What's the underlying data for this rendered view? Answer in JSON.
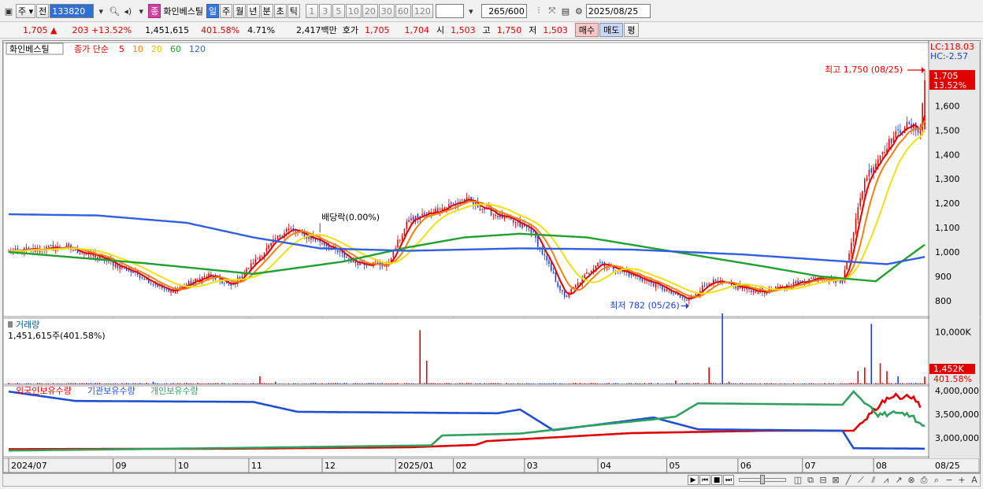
{
  "toolbar": {
    "period_select": "주",
    "prev_label": "전",
    "stock_code": "133820",
    "stock_badge": "종",
    "stock_name": "화인베스틸",
    "period_buttons": [
      "일",
      "주",
      "월",
      "년",
      "분",
      "초",
      "틱"
    ],
    "active_period": "일",
    "interval_buttons": [
      "1",
      "3",
      "5",
      "10",
      "20",
      "30",
      "60",
      "120"
    ],
    "count_value": "265",
    "count_total": "/600",
    "date_value": "2025/08/25"
  },
  "quote": {
    "price": "1,705",
    "change": "203",
    "change_rate": "+13.52%",
    "volume": "1,451,615",
    "volume_rate": "401.58%",
    "turnover": "4.71%",
    "amount": "2,417백만",
    "hoga_label": "호가",
    "ask": "1,705",
    "bid": "1,704",
    "open_label": "시",
    "open": "1,503",
    "high_label": "고",
    "high": "1,750",
    "low_label": "저",
    "low": "1,503",
    "buy_label": "매수",
    "sell_label": "매도",
    "eval_label": "평"
  },
  "colors": {
    "up": "#e00000",
    "down": "#1a3fcf",
    "ma5": "#e00000",
    "ma10": "#f08010",
    "ma20": "#f0e010",
    "ma60": "#20a030",
    "ma120": "#3060e0",
    "foreign": "#e00000",
    "institution": "#2050d0",
    "individual": "#30a060"
  },
  "chart_data": {
    "type": "candlestick",
    "price_panel": {
      "stock_label": "화인베스틸",
      "ma_title": "종가 단순",
      "ma_periods": [
        "5",
        "10",
        "20",
        "60",
        "120"
      ],
      "y_ticks": [
        "1,600",
        "1,500",
        "1,400",
        "1,300",
        "1,200",
        "1,100",
        "1,000",
        "900",
        "800"
      ],
      "ylim": [
        735,
        1860
      ],
      "lc_label": "LC:118.03",
      "hc_label": "HC:-2.57",
      "last_price_tag": "1,705",
      "last_rate_tag": "13.52%",
      "high_annotation": "최고 1,750 (08/25)",
      "low_annotation": "최저 782 (05/26)",
      "dividend_annotation": "배당락(0.00%)",
      "segments": [
        {
          "from": 0,
          "to": 25,
          "start": 1000,
          "end": 1020
        },
        {
          "from": 25,
          "to": 40,
          "start": 1020,
          "end": 980
        },
        {
          "from": 40,
          "to": 60,
          "start": 980,
          "end": 900
        },
        {
          "from": 60,
          "to": 72,
          "start": 900,
          "end": 835
        },
        {
          "from": 72,
          "to": 90,
          "start": 835,
          "end": 905
        },
        {
          "from": 90,
          "to": 100,
          "start": 905,
          "end": 860
        },
        {
          "from": 100,
          "to": 110,
          "start": 860,
          "end": 955
        },
        {
          "from": 110,
          "to": 125,
          "start": 955,
          "end": 1095
        },
        {
          "from": 125,
          "to": 140,
          "start": 1095,
          "end": 1045
        },
        {
          "from": 140,
          "to": 155,
          "start": 1045,
          "end": 960
        },
        {
          "from": 155,
          "to": 170,
          "start": 960,
          "end": 945
        },
        {
          "from": 170,
          "to": 180,
          "start": 945,
          "end": 1130
        },
        {
          "from": 180,
          "to": 195,
          "start": 1130,
          "end": 1180
        },
        {
          "from": 195,
          "to": 205,
          "start": 1180,
          "end": 1215
        },
        {
          "from": 205,
          "to": 225,
          "start": 1215,
          "end": 1130
        },
        {
          "from": 225,
          "to": 235,
          "start": 1130,
          "end": 1090
        },
        {
          "from": 235,
          "to": 250,
          "start": 1090,
          "end": 810
        },
        {
          "from": 250,
          "to": 265,
          "start": 810,
          "end": 960
        },
        {
          "from": 265,
          "to": 290,
          "start": 960,
          "end": 870
        },
        {
          "from": 290,
          "to": 305,
          "start": 870,
          "end": 800
        },
        {
          "from": 305,
          "to": 315,
          "start": 800,
          "end": 880
        },
        {
          "from": 315,
          "to": 340,
          "start": 880,
          "end": 835
        },
        {
          "from": 340,
          "to": 365,
          "start": 835,
          "end": 900
        },
        {
          "from": 365,
          "to": 375,
          "start": 900,
          "end": 880
        },
        {
          "from": 375,
          "to": 385,
          "start": 880,
          "end": 1300
        },
        {
          "from": 385,
          "to": 395,
          "start": 1300,
          "end": 1440
        },
        {
          "from": 395,
          "to": 403,
          "start": 1440,
          "end": 1520
        },
        {
          "from": 403,
          "to": 410,
          "start": 1520,
          "end": 1503
        },
        {
          "from": 410,
          "to": 412,
          "start": 1503,
          "end": 1705
        }
      ],
      "ma60": [
        [
          0,
          1000
        ],
        [
          60,
          955
        ],
        [
          110,
          910
        ],
        [
          150,
          960
        ],
        [
          180,
          1020
        ],
        [
          205,
          1060
        ],
        [
          230,
          1075
        ],
        [
          260,
          1060
        ],
        [
          300,
          1000
        ],
        [
          340,
          940
        ],
        [
          365,
          900
        ],
        [
          390,
          880
        ],
        [
          400,
          950
        ],
        [
          412,
          1030
        ]
      ],
      "ma120": [
        [
          0,
          1155
        ],
        [
          40,
          1150
        ],
        [
          80,
          1120
        ],
        [
          110,
          1060
        ],
        [
          140,
          1015
        ],
        [
          180,
          1005
        ],
        [
          230,
          1015
        ],
        [
          280,
          1010
        ],
        [
          330,
          990
        ],
        [
          370,
          965
        ],
        [
          395,
          950
        ],
        [
          412,
          980
        ]
      ]
    },
    "volume_panel": {
      "title": "거래량",
      "summary": "1,451,615주(401.58%)",
      "y_tick": "10,000K",
      "ylim": [
        0,
        12000
      ],
      "last_tag": "1,452K",
      "last_rate": "401.58%",
      "spikes": [
        [
          65,
          500
        ],
        [
          113,
          1500
        ],
        [
          120,
          500
        ],
        [
          185,
          10300
        ],
        [
          188,
          4500
        ],
        [
          300,
          700
        ],
        [
          315,
          3200
        ],
        [
          321,
          13500
        ],
        [
          324,
          500
        ],
        [
          382,
          2500
        ],
        [
          385,
          3200
        ],
        [
          388,
          11500
        ],
        [
          392,
          4000
        ],
        [
          395,
          2500
        ],
        [
          400,
          1500
        ]
      ]
    },
    "holding_panel": {
      "legend": [
        "외국인보유수량",
        "기관보유수량",
        "개인보유수량"
      ],
      "y_ticks": [
        "4,000,000",
        "3,500,000",
        "3,000,000"
      ],
      "ylim": [
        2600000,
        4100000
      ],
      "foreign": [
        [
          0,
          2760000
        ],
        [
          100,
          2770000
        ],
        [
          180,
          2800000
        ],
        [
          210,
          2850000
        ],
        [
          215,
          2930000
        ],
        [
          280,
          3100000
        ],
        [
          340,
          3150000
        ],
        [
          380,
          3150000
        ],
        [
          385,
          3400000
        ],
        [
          395,
          3850000
        ],
        [
          405,
          3900000
        ],
        [
          410,
          3700000
        ]
      ],
      "institution": [
        [
          0,
          3980000
        ],
        [
          30,
          3780000
        ],
        [
          110,
          3760000
        ],
        [
          130,
          3550000
        ],
        [
          220,
          3520000
        ],
        [
          230,
          3600000
        ],
        [
          245,
          3160000
        ],
        [
          290,
          3430000
        ],
        [
          310,
          3180000
        ],
        [
          375,
          3150000
        ],
        [
          380,
          2780000
        ],
        [
          412,
          2770000
        ]
      ],
      "individual": [
        [
          0,
          2730000
        ],
        [
          110,
          2790000
        ],
        [
          190,
          2840000
        ],
        [
          195,
          3050000
        ],
        [
          230,
          3090000
        ],
        [
          260,
          3250000
        ],
        [
          290,
          3390000
        ],
        [
          300,
          3450000
        ],
        [
          310,
          3730000
        ],
        [
          375,
          3700000
        ],
        [
          380,
          3980000
        ],
        [
          390,
          3500000
        ],
        [
          405,
          3500000
        ],
        [
          412,
          3200000
        ]
      ]
    },
    "x_axis": {
      "labels": [
        {
          "i": 0,
          "t": "2024/07"
        },
        {
          "i": 47,
          "t": "09"
        },
        {
          "i": 75,
          "t": "10"
        },
        {
          "i": 108,
          "t": "11"
        },
        {
          "i": 141,
          "t": "12"
        },
        {
          "i": 174,
          "t": "2025/01"
        },
        {
          "i": 200,
          "t": "02"
        },
        {
          "i": 232,
          "t": "03"
        },
        {
          "i": 265,
          "t": "04"
        },
        {
          "i": 296,
          "t": "05"
        },
        {
          "i": 328,
          "t": "06"
        },
        {
          "i": 357,
          "t": "07"
        },
        {
          "i": 389,
          "t": "08"
        }
      ],
      "last_date": "08/25",
      "count": 413
    }
  }
}
